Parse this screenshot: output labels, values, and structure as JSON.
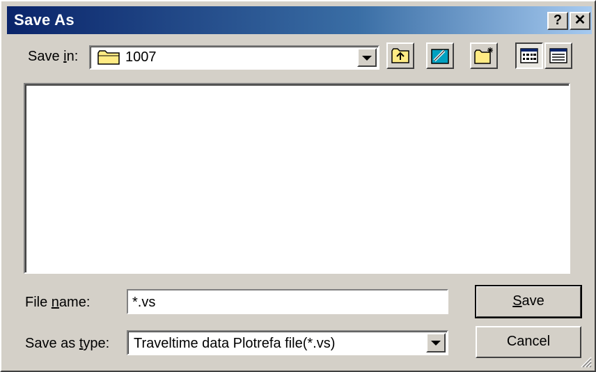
{
  "window": {
    "title": "Save As"
  },
  "titlebar_buttons": {
    "help": "?",
    "close": "✕"
  },
  "save_in": {
    "label_pre": "Save ",
    "label_accel": "i",
    "label_post": "n:",
    "value": "1007"
  },
  "toolbar": {
    "icons": [
      "up-one-level-icon",
      "desktop-icon",
      "new-folder-icon",
      "list-view-icon",
      "details-view-icon"
    ]
  },
  "file_name": {
    "label_pre": "File ",
    "label_accel": "n",
    "label_post": "ame:",
    "value": "*.vs"
  },
  "save_as_type": {
    "label_pre": "Save as ",
    "label_accel": "t",
    "label_post": "ype:",
    "value": "Traveltime data Plotrefa file(*.vs)"
  },
  "buttons": {
    "save_accel": "S",
    "save_rest": "ave",
    "cancel": "Cancel"
  },
  "colors": {
    "face": "#d4d0c8",
    "title_start": "#0a246a",
    "title_end": "#a6caf0"
  }
}
